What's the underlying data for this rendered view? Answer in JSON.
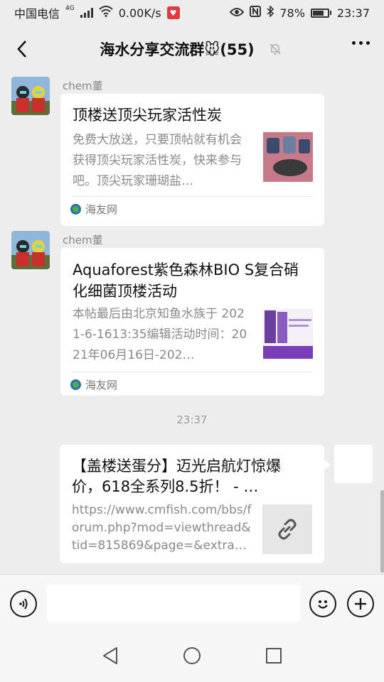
{
  "status_bar": {
    "carrier": "中国电信",
    "network_type": "4G",
    "speed": "0.00K/s",
    "battery": "78%",
    "battery_level": 0.78,
    "time": "23:37"
  },
  "nav": {
    "title": "海水分享交流群🐭(55)"
  },
  "messages": [
    {
      "sender": "chem董",
      "title": "顶楼送顶尖玩家活性炭",
      "desc": "免费大放送，只要顶帖就有机会获得顶尖玩家活性炭，快来参与吧。顶尖玩家珊瑚盐…",
      "source": "海友网"
    },
    {
      "sender": "chem董",
      "title": "Aquaforest紫色森林BIO S复合硝化细菌顶楼活动",
      "desc": "本帖最后由北京知鱼水族于 2021-6-1613:35编辑活动时间：2021年06月16日-202…",
      "source": "海友网"
    }
  ],
  "timestamp": "23:37",
  "outgoing": {
    "title": "【盖楼送蛋分】迈光启航灯惊爆价，618全系列8.5折！ - …",
    "desc": "https://www.cmfish.com/bbs/forum.php?mod=viewthread&tid=815869&page=&extra…"
  },
  "icons": {
    "back": "back-arrow-icon",
    "mute": "mute-bell-icon",
    "more": "more-dots-icon",
    "voice": "voice-icon",
    "emoji": "emoji-icon",
    "plus": "plus-icon",
    "link": "link-icon"
  }
}
